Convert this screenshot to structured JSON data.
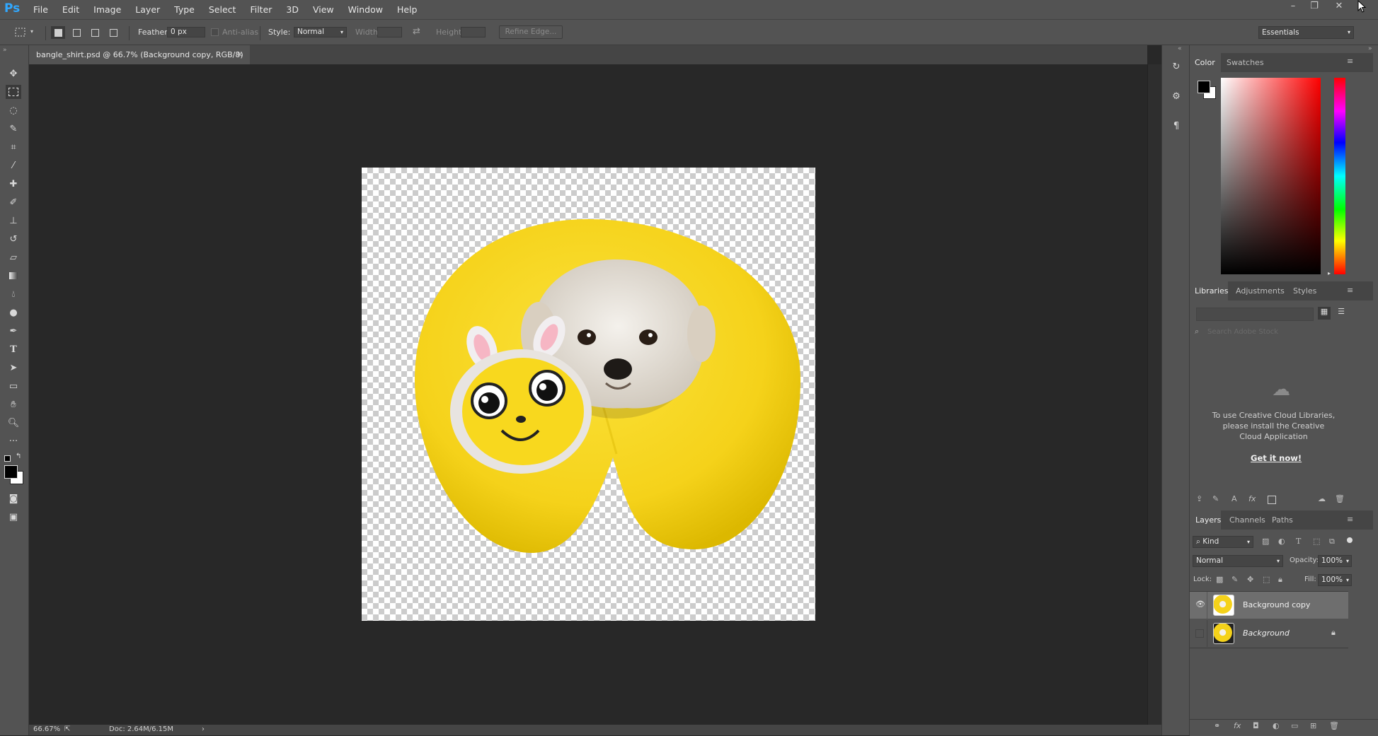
{
  "app": {
    "logo": "Ps"
  },
  "menu": [
    "File",
    "Edit",
    "Image",
    "Layer",
    "Type",
    "Select",
    "Filter",
    "3D",
    "View",
    "Window",
    "Help"
  ],
  "window_controls": {
    "minimize": "–",
    "restore": "❐",
    "close": "✕"
  },
  "options": {
    "feather_label": "Feather:",
    "feather_value": "0 px",
    "antialias_label": "Anti-alias",
    "style_label": "Style:",
    "style_value": "Normal",
    "width_label": "Width:",
    "height_label": "Height:",
    "refine_edge_label": "Refine Edge...",
    "workspace_value": "Essentials"
  },
  "document": {
    "tab_title": "bangle_shirt.psd @ 66.7% (Background copy, RGB/8)",
    "close": "×"
  },
  "status": {
    "zoom": "66.67%",
    "doc": "Doc: 2.64M/6.15M",
    "arrow": "›"
  },
  "color_panel": {
    "tabs": [
      "Color",
      "Swatches"
    ],
    "active": "Color",
    "foreground": "#000000",
    "background": "#ffffff",
    "hue": "#ff0000"
  },
  "libraries_panel": {
    "tabs": [
      "Libraries",
      "Adjustments",
      "Styles"
    ],
    "active": "Libraries",
    "search_placeholder": "Search Adobe Stock",
    "message": "To use Creative Cloud Libraries, please install the Creative Cloud Application",
    "cta": "Get it now!"
  },
  "layers_panel": {
    "tabs": [
      "Layers",
      "Channels",
      "Paths"
    ],
    "active": "Layers",
    "filter_value": "Kind",
    "blend_mode": "Normal",
    "opacity_label": "Opacity:",
    "opacity_value": "100%",
    "lock_label": "Lock:",
    "fill_label": "Fill:",
    "fill_value": "100%",
    "layers": [
      {
        "name": "Background copy",
        "visible": true,
        "selected": true,
        "locked": false
      },
      {
        "name": "Background",
        "visible": false,
        "selected": false,
        "locked": true
      }
    ]
  },
  "colors": {
    "ui_bg": "#535353",
    "canvas_bg": "#282828",
    "selection": "#6e6e6e",
    "ps_blue": "#31a8ff",
    "pillow": "#f5d21a"
  }
}
